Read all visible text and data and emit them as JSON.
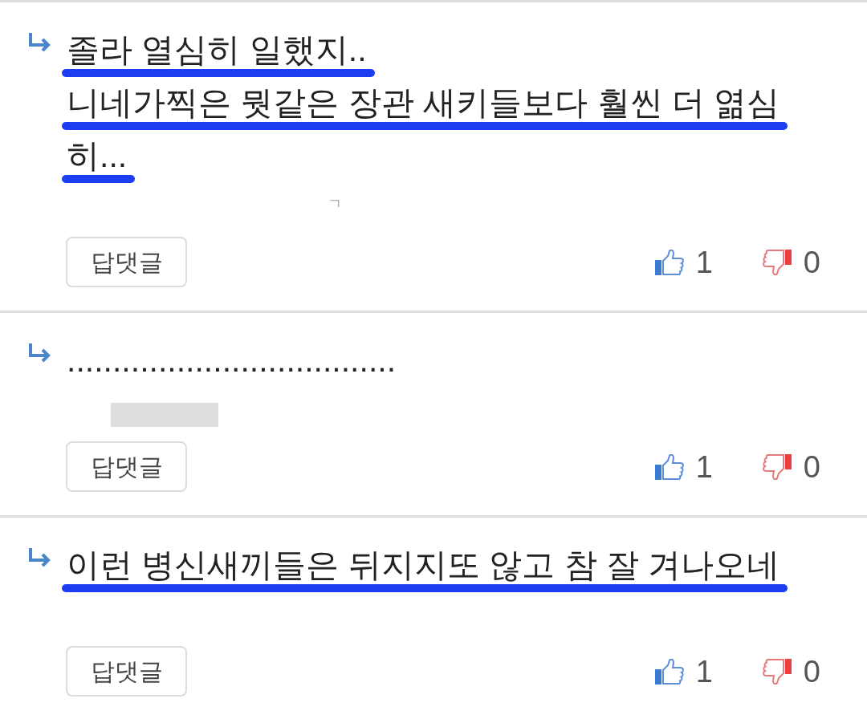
{
  "comments": [
    {
      "lines": [
        {
          "text": "졸라 열심히 일했지..",
          "underlined": true
        },
        {
          "text": "니네가찍은 뭣같은 장관 새키들보다 훨씬 더 엶심",
          "underlined": true
        },
        {
          "text": "히...",
          "underlined": true
        }
      ],
      "meta": {
        "kind": "fragment",
        "text": "ㄱ"
      },
      "reply_button": "답댓글",
      "likes": "1",
      "dislikes": "0"
    },
    {
      "lines": [
        {
          "text": "....................................",
          "underlined": false
        }
      ],
      "meta": {
        "kind": "redacted"
      },
      "reply_button": "답댓글",
      "likes": "1",
      "dislikes": "0"
    },
    {
      "lines": [
        {
          "text": "이런 병신새끼들은 뒤지지또 않고 참 잘 겨나오네",
          "underlined": true
        }
      ],
      "reply_button": "답댓글",
      "likes": "1",
      "dislikes": "0"
    }
  ]
}
